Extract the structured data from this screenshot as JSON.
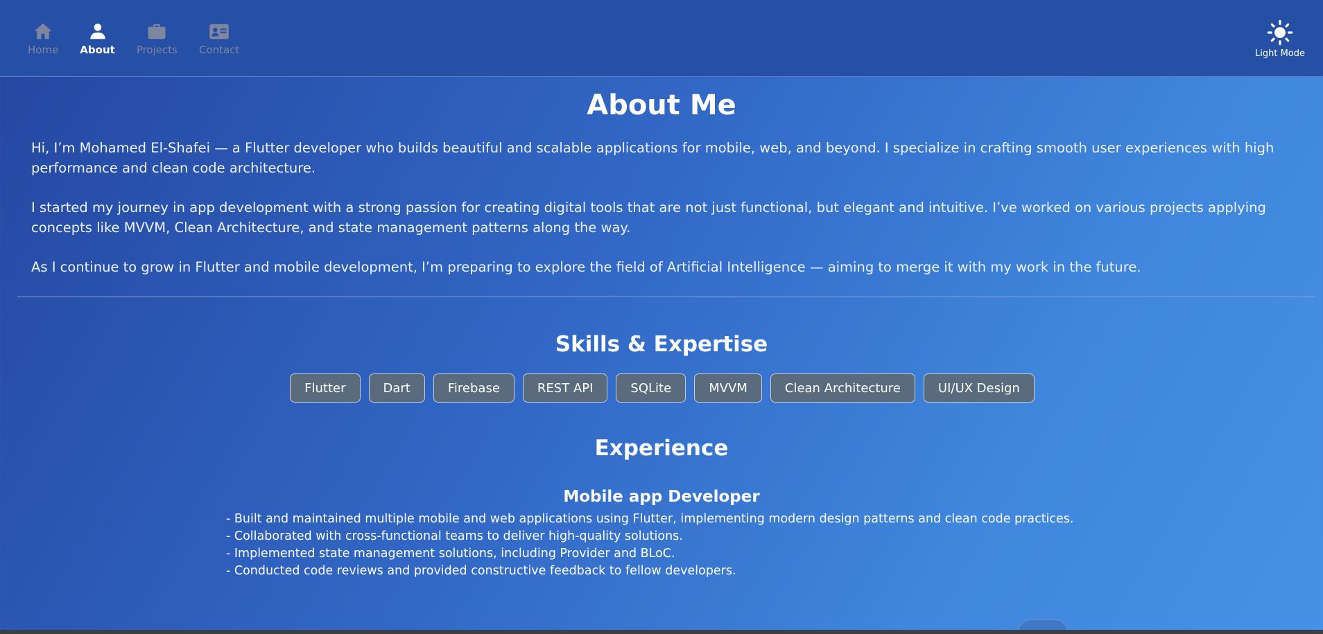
{
  "nav": {
    "items": [
      {
        "label": "Home",
        "icon": "home-icon",
        "active": false
      },
      {
        "label": "About",
        "icon": "person-icon",
        "active": true
      },
      {
        "label": "Projects",
        "icon": "briefcase-icon",
        "active": false
      },
      {
        "label": "Contact",
        "icon": "contact-card-icon",
        "active": false
      }
    ]
  },
  "theme_toggle": {
    "label": "Light Mode",
    "icon": "sun-icon"
  },
  "about": {
    "title": "About Me",
    "paragraphs": [
      "Hi, I’m Mohamed El-Shafei — a Flutter developer who builds beautiful and scalable applications for mobile, web, and beyond. I specialize in crafting smooth user experiences with high performance and clean code architecture.",
      "I started my journey in app development with a strong passion for creating digital tools that are not just functional, but elegant and intuitive. I’ve worked on various projects applying concepts like MVVM, Clean Architecture, and state management patterns along the way.",
      "As I continue to grow in Flutter and mobile development, I’m preparing to explore the field of Artificial Intelligence — aiming to merge it with my work in the future."
    ]
  },
  "skills": {
    "title": "Skills & Expertise",
    "items": [
      "Flutter",
      "Dart",
      "Firebase",
      "REST API",
      "SQLite",
      "MVVM",
      "Clean Architecture",
      "UI/UX Design"
    ]
  },
  "experience": {
    "title": "Experience",
    "job_title": "Mobile app Developer",
    "bullets": [
      "- Built and maintained multiple mobile and web applications using Flutter, implementing modern design patterns and clean code practices.",
      "- Collaborated with cross-functional teams to deliver high-quality solutions.",
      "- Implemented state management solutions, including Provider and BLoC.",
      "- Conducted code reviews and provided constructive feedback to fellow developers."
    ]
  },
  "colors": {
    "topbar": "#2550a6",
    "chip_background": "#5a6b7e",
    "inactive_nav": "#7e86a0"
  }
}
